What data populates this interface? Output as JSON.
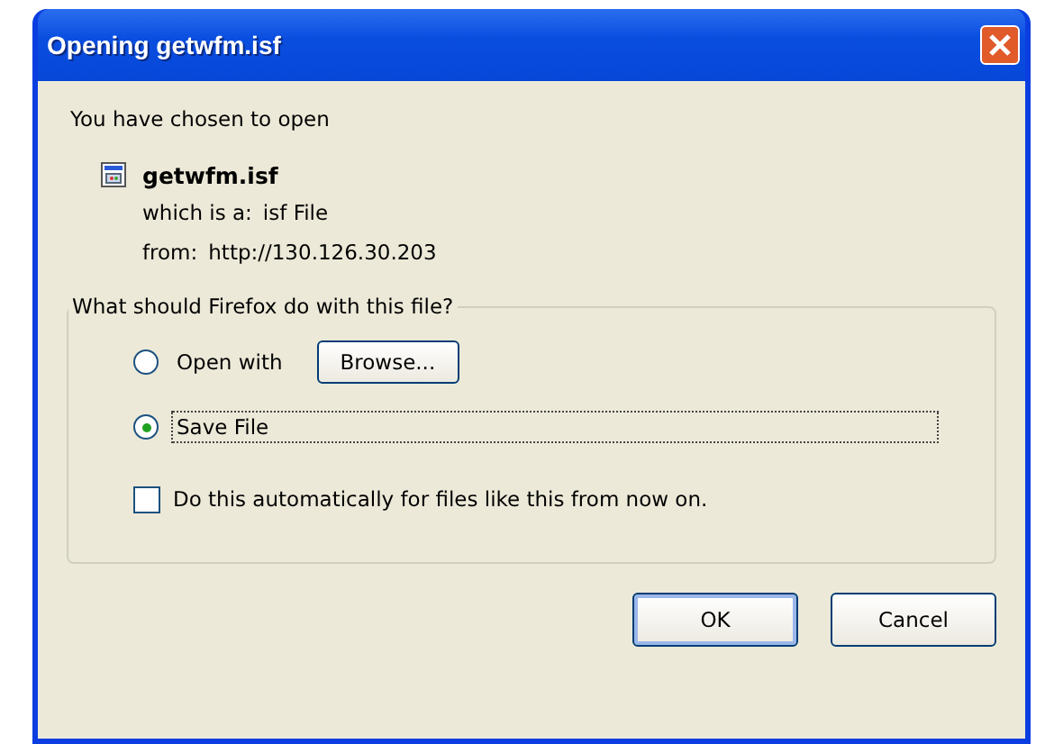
{
  "window": {
    "title": "Opening getwfm.isf"
  },
  "intro": "You have chosen to open",
  "file": {
    "name": "getwfm.isf",
    "type_label": "which is a:",
    "type_value": "isf File",
    "from_label": "from:",
    "from_value": "http://130.126.30.203"
  },
  "group": {
    "legend": "What should Firefox do with this file?",
    "options": [
      {
        "label": "Open with",
        "selected": false,
        "focused": false,
        "button": "Browse..."
      },
      {
        "label": "Save File",
        "selected": true,
        "focused": true
      }
    ],
    "checkbox": {
      "label": "Do this automatically for files like this from now on.",
      "checked": false
    }
  },
  "buttons": [
    {
      "label": "OK",
      "default": true
    },
    {
      "label": "Cancel",
      "default": false
    }
  ]
}
